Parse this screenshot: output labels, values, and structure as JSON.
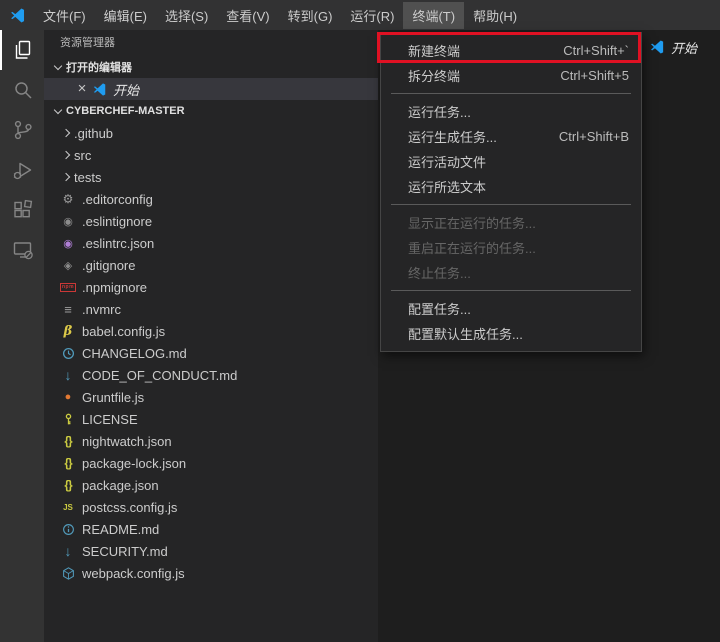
{
  "titlebar": {
    "menus": [
      {
        "label": "文件(F)",
        "active": false
      },
      {
        "label": "编辑(E)",
        "active": false
      },
      {
        "label": "选择(S)",
        "active": false
      },
      {
        "label": "查看(V)",
        "active": false
      },
      {
        "label": "转到(G)",
        "active": false
      },
      {
        "label": "运行(R)",
        "active": false
      },
      {
        "label": "终端(T)",
        "active": true
      },
      {
        "label": "帮助(H)",
        "active": false
      }
    ]
  },
  "activity_bar": {
    "items": [
      {
        "name": "explorer",
        "icon": "files-icon",
        "active": true
      },
      {
        "name": "search",
        "icon": "search-icon",
        "active": false
      },
      {
        "name": "source-control",
        "icon": "branch-icon",
        "active": false
      },
      {
        "name": "run-debug",
        "icon": "debug-icon",
        "active": false
      },
      {
        "name": "extensions",
        "icon": "extensions-icon",
        "active": false
      },
      {
        "name": "remote-explorer",
        "icon": "remote-icon",
        "active": false
      }
    ]
  },
  "sidebar": {
    "title": "资源管理器",
    "open_editors": {
      "label": "打开的编辑器",
      "editor": {
        "label": "开始",
        "selected": true,
        "close_glyph": "×"
      }
    },
    "workspace": {
      "label": "CYBERCHEF-MASTER"
    },
    "tree": [
      {
        "type": "folder",
        "label": ".github"
      },
      {
        "type": "folder",
        "label": "src"
      },
      {
        "type": "folder",
        "label": "tests"
      },
      {
        "type": "file",
        "label": ".editorconfig",
        "icon": "gear-icon",
        "color": "#9d9d9d"
      },
      {
        "type": "file",
        "label": ".eslintignore",
        "icon": "eslint-icon",
        "color": "#8c8c8c"
      },
      {
        "type": "file",
        "label": ".eslintrc.json",
        "icon": "eslint-icon",
        "color": "#b07fd6"
      },
      {
        "type": "file",
        "label": ".gitignore",
        "icon": "git-diamond-icon",
        "color": "#8c8c8c"
      },
      {
        "type": "file",
        "label": ".npmignore",
        "icon": "npm-icon",
        "color": "#cb3837"
      },
      {
        "type": "file",
        "label": ".nvmrc",
        "icon": "lines-icon",
        "color": "#9d9d9d"
      },
      {
        "type": "file",
        "label": "babel.config.js",
        "icon": "babel-icon",
        "color": "#dcc949"
      },
      {
        "type": "file",
        "label": "CHANGELOG.md",
        "icon": "clock-icon",
        "color": "#519aba"
      },
      {
        "type": "file",
        "label": "CODE_OF_CONDUCT.md",
        "icon": "markdown-arrow-icon",
        "color": "#519aba"
      },
      {
        "type": "file",
        "label": "Gruntfile.js",
        "icon": "grunt-icon",
        "color": "#e37933"
      },
      {
        "type": "file",
        "label": "LICENSE",
        "icon": "key-icon",
        "color": "#cbcb41"
      },
      {
        "type": "file",
        "label": "nightwatch.json",
        "icon": "braces-icon",
        "color": "#cbcb41"
      },
      {
        "type": "file",
        "label": "package-lock.json",
        "icon": "braces-icon",
        "color": "#cbcb41"
      },
      {
        "type": "file",
        "label": "package.json",
        "icon": "braces-icon",
        "color": "#cbcb41"
      },
      {
        "type": "file",
        "label": "postcss.config.js",
        "icon": "js-icon",
        "color": "#cbcb41"
      },
      {
        "type": "file",
        "label": "README.md",
        "icon": "info-icon",
        "color": "#519aba"
      },
      {
        "type": "file",
        "label": "SECURITY.md",
        "icon": "markdown-arrow-icon",
        "color": "#519aba"
      },
      {
        "type": "file",
        "label": "webpack.config.js",
        "icon": "webpack-icon",
        "color": "#519aba"
      }
    ]
  },
  "editor": {
    "tab": {
      "label": "开始"
    }
  },
  "terminal_menu": {
    "groups": [
      {
        "items": [
          {
            "label": "新建终端",
            "shortcut": "Ctrl+Shift+`",
            "annotated": true,
            "disabled": false
          },
          {
            "label": "拆分终端",
            "shortcut": "Ctrl+Shift+5",
            "disabled": false
          }
        ]
      },
      {
        "items": [
          {
            "label": "运行任务...",
            "shortcut": "",
            "disabled": false
          },
          {
            "label": "运行生成任务...",
            "shortcut": "Ctrl+Shift+B",
            "disabled": false
          },
          {
            "label": "运行活动文件",
            "shortcut": "",
            "disabled": false
          },
          {
            "label": "运行所选文本",
            "shortcut": "",
            "disabled": false
          }
        ]
      },
      {
        "items": [
          {
            "label": "显示正在运行的任务...",
            "shortcut": "",
            "disabled": true
          },
          {
            "label": "重启正在运行的任务...",
            "shortcut": "",
            "disabled": true
          },
          {
            "label": "终止任务...",
            "shortcut": "",
            "disabled": true
          }
        ]
      },
      {
        "items": [
          {
            "label": "配置任务...",
            "shortcut": "",
            "disabled": false
          },
          {
            "label": "配置默认生成任务...",
            "shortcut": "",
            "disabled": false
          }
        ]
      }
    ]
  },
  "annotation": {
    "color": "#e01123"
  },
  "colors": {
    "titlebar": "#323233",
    "activitybar": "#333333",
    "sidebar": "#252526",
    "editor": "#1e1e1e",
    "menu": "#252526",
    "selected_row": "#37373d",
    "logo_blue": "#1f9cf0",
    "annotation_red": "#e01123"
  }
}
